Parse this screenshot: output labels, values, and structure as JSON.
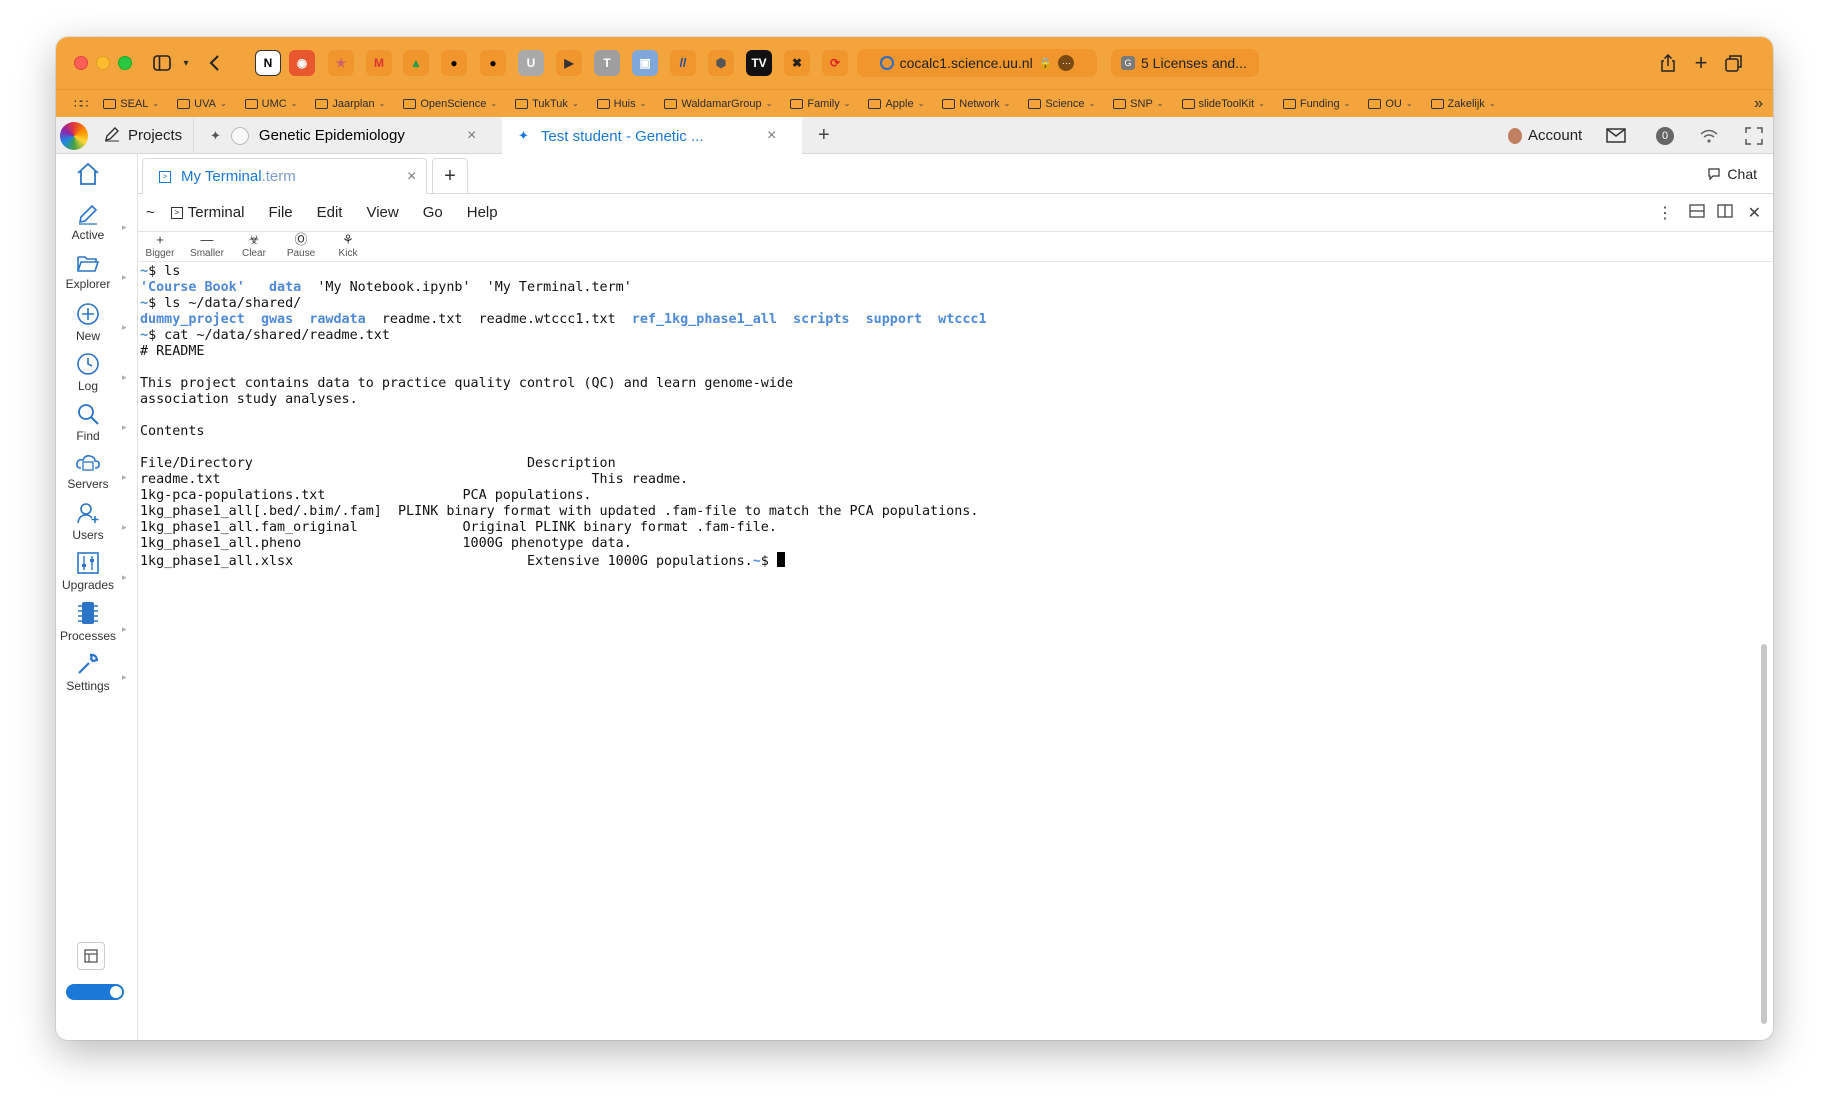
{
  "browser": {
    "url": "cocalc1.science.uu.nl",
    "second_tab": "5 Licenses and...",
    "bookmarks": [
      "SEAL",
      "UVA",
      "UMC",
      "Jaarplan",
      "OpenScience",
      "TukTuk",
      "Huis",
      "WaldamarGroup",
      "Family",
      "Apple",
      "Network",
      "Science",
      "SNP",
      "slideToolKit",
      "Funding",
      "OU",
      "Zakelijk"
    ]
  },
  "apptabs": {
    "projects": "Projects",
    "genetic": "Genetic Epidemiology",
    "test": "Test student - Genetic ...",
    "account": "Account",
    "notif_count": "0"
  },
  "sidebar": {
    "items": [
      {
        "label": "Active"
      },
      {
        "label": "Explorer"
      },
      {
        "label": "New"
      },
      {
        "label": "Log"
      },
      {
        "label": "Find"
      },
      {
        "label": "Servers"
      },
      {
        "label": "Users"
      },
      {
        "label": "Upgrades"
      },
      {
        "label": "Processes"
      },
      {
        "label": "Settings"
      }
    ]
  },
  "file": {
    "tab_name": "My Terminal",
    "tab_ext": ".term",
    "chat": "Chat"
  },
  "menu": {
    "tilde": "~",
    "items": [
      "Terminal",
      "File",
      "Edit",
      "View",
      "Go",
      "Help"
    ]
  },
  "tools": [
    "Bigger",
    "Smaller",
    "Clear",
    "Pause",
    "Kick"
  ],
  "terminal": {
    "lines": [
      [
        {
          "t": "~",
          "c": "blue"
        },
        {
          "t": "$ ls"
        }
      ],
      [
        {
          "t": "'Course Book'",
          "c": "blue"
        },
        {
          "t": "   "
        },
        {
          "t": "data",
          "c": "blue"
        },
        {
          "t": "  'My Notebook.ipynb'  'My Terminal.term'"
        }
      ],
      [
        {
          "t": "~",
          "c": "blue"
        },
        {
          "t": "$ ls ~/data/shared/"
        }
      ],
      [
        {
          "t": "dummy_project",
          "c": "blue"
        },
        {
          "t": "  "
        },
        {
          "t": "gwas",
          "c": "blue"
        },
        {
          "t": "  "
        },
        {
          "t": "rawdata",
          "c": "blue"
        },
        {
          "t": "  readme.txt  readme.wtccc1.txt  "
        },
        {
          "t": "ref_1kg_phase1_all",
          "c": "blue"
        },
        {
          "t": "  "
        },
        {
          "t": "scripts",
          "c": "blue"
        },
        {
          "t": "  "
        },
        {
          "t": "support",
          "c": "blue"
        },
        {
          "t": "  "
        },
        {
          "t": "wtccc1",
          "c": "blue"
        }
      ],
      [
        {
          "t": "~",
          "c": "blue"
        },
        {
          "t": "$ cat ~/data/shared/readme.txt"
        }
      ],
      [
        {
          "t": "# README"
        }
      ],
      [
        {
          "t": ""
        }
      ],
      [
        {
          "t": "This project contains data to practice quality control (QC) and learn genome-wide"
        }
      ],
      [
        {
          "t": "association study analyses."
        }
      ],
      [
        {
          "t": ""
        }
      ],
      [
        {
          "t": "Contents"
        }
      ],
      [
        {
          "t": ""
        }
      ],
      [
        {
          "t": "File/Directory                                  Description"
        }
      ],
      [
        {
          "t": "readme.txt                                              This readme."
        }
      ],
      [
        {
          "t": "1kg-pca-populations.txt                 PCA populations."
        }
      ],
      [
        {
          "t": "1kg_phase1_all[.bed/.bim/.fam]  PLINK binary format with updated .fam-file to match the PCA populations."
        }
      ],
      [
        {
          "t": "1kg_phase1_all.fam_original             Original PLINK binary format .fam-file."
        }
      ],
      [
        {
          "t": "1kg_phase1_all.pheno                    1000G phenotype data."
        }
      ],
      [
        {
          "t": "1kg_phase1_all.xlsx                             Extensive 1000G populations."
        },
        {
          "t": "~",
          "c": "blue"
        },
        {
          "t": "$ "
        },
        {
          "t": "",
          "c": "cursor"
        }
      ]
    ]
  },
  "colors": {
    "titlebar": "#f4a43c",
    "accent": "#1b78d6",
    "terminal_blue": "#4f8ad8"
  }
}
